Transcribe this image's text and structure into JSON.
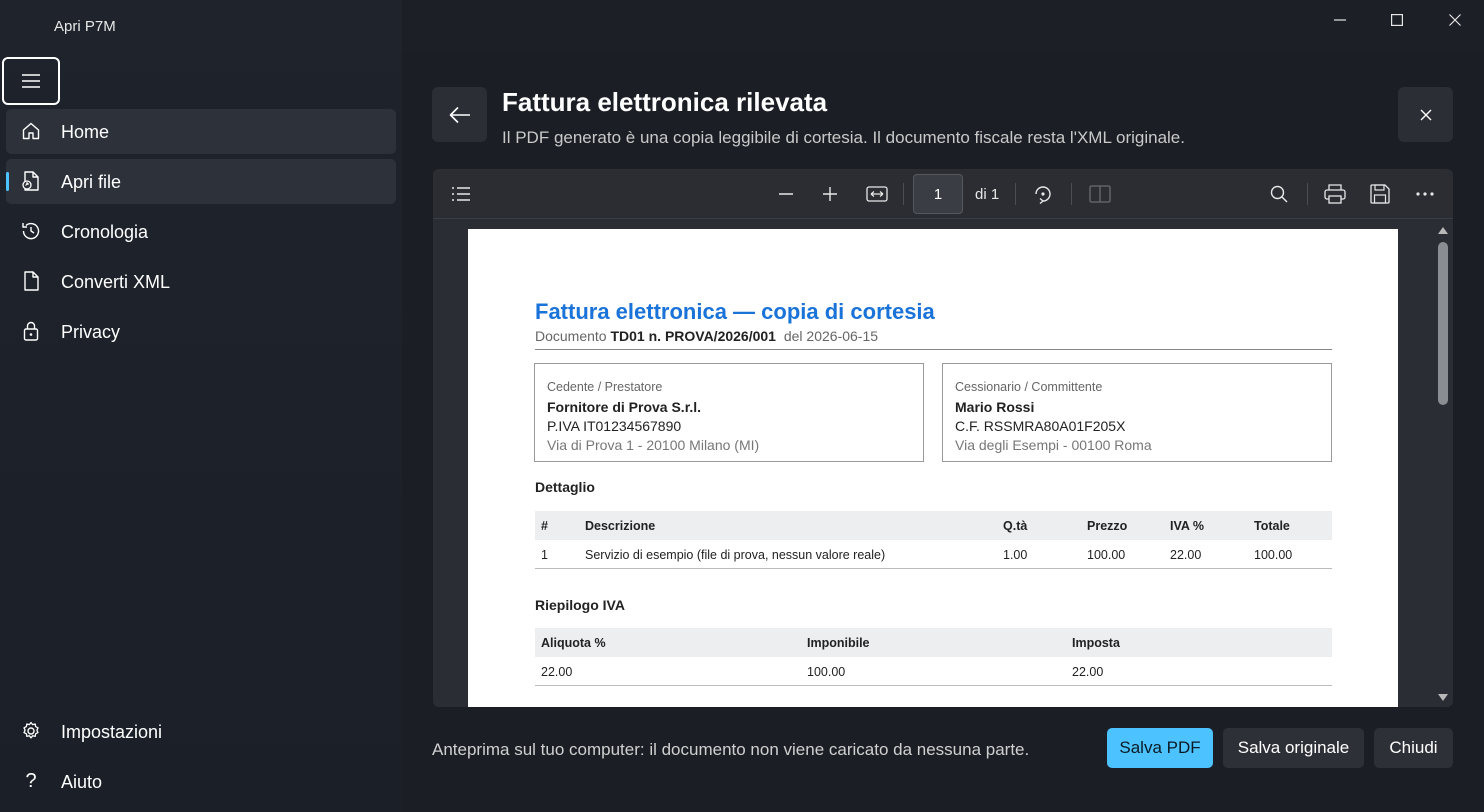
{
  "window": {
    "title": "Apri P7M",
    "minimize_glyph": "—",
    "maximize_glyph": "☐",
    "close_glyph": "✕"
  },
  "sidebar": {
    "items": [
      {
        "label": "Home",
        "icon": "home-icon"
      },
      {
        "label": "Apri file",
        "icon": "open-file-icon"
      },
      {
        "label": "Cronologia",
        "icon": "history-icon"
      },
      {
        "label": "Converti XML",
        "icon": "document-icon"
      },
      {
        "label": "Privacy",
        "icon": "lock-icon"
      }
    ],
    "bottom_items": [
      {
        "label": "Impostazioni",
        "icon": "gear-icon"
      },
      {
        "label": "Aiuto",
        "icon": "help-icon"
      }
    ]
  },
  "header": {
    "title": "Fattura elettronica rilevata",
    "subtitle": "Il PDF generato è una copia leggibile di cortesia. Il documento fiscale resta l'XML originale."
  },
  "viewer": {
    "current_page": "1",
    "page_of": "di 1"
  },
  "document": {
    "title": "Fattura elettronica — copia di cortesia",
    "meta_prefix": "Documento",
    "doc_number": "TD01 n. PROVA/2026/001",
    "meta_date": "del 2026-06-15",
    "cedente": {
      "label": "Cedente / Prestatore",
      "name": "Fornitore di Prova S.r.l.",
      "id": "P.IVA IT01234567890",
      "address": "Via di Prova 1 - 20100 Milano (MI)"
    },
    "cessionario": {
      "label": "Cessionario / Committente",
      "name": "Mario Rossi",
      "id": "C.F. RSSMRA80A01F205X",
      "address": "Via degli Esempi - 00100 Roma"
    },
    "detail_heading": "Dettaglio",
    "detail_columns": [
      "#",
      "Descrizione",
      "Q.tà",
      "Prezzo",
      "IVA %",
      "Totale"
    ],
    "detail_rows": [
      [
        "1",
        "Servizio di esempio (file di prova, nessun valore reale)",
        "1.00",
        "100.00",
        "22.00",
        "100.00"
      ]
    ],
    "summary_heading": "Riepilogo IVA",
    "summary_columns": [
      "Aliquota %",
      "Imponibile",
      "Imposta"
    ],
    "summary_rows": [
      [
        "22.00",
        "100.00",
        "22.00"
      ]
    ]
  },
  "footer": {
    "note": "Anteprima sul tuo computer: il documento non viene caricato da nessuna parte.",
    "save_pdf": "Salva PDF",
    "save_original": "Salva originale",
    "close": "Chiudi"
  },
  "colors": {
    "accent": "#4cc2ff",
    "doc_title": "#1a73d9"
  }
}
